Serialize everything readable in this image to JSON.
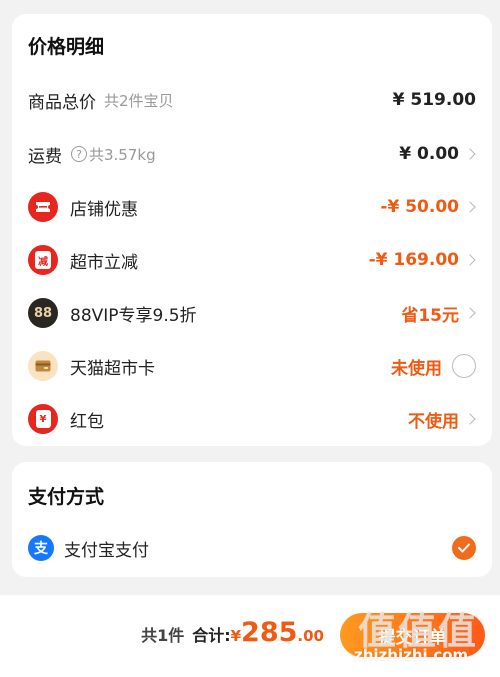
{
  "price_detail": {
    "title": "价格明细",
    "rows": [
      {
        "label": "商品总价",
        "sub": "共2件宝贝",
        "value": "¥ 519.00"
      },
      {
        "label": "运费",
        "sub": "共3.57kg",
        "value": "¥ 0.00"
      },
      {
        "label": "店铺优惠",
        "value": "-¥ 50.00",
        "icon": "ticket-icon"
      },
      {
        "label": "超市立减",
        "value": "-¥ 169.00",
        "icon": "reduction-badge-icon",
        "icon_text": "减"
      },
      {
        "label": "88VIP专享9.5折",
        "value": "省15元",
        "icon": "vip88-icon",
        "icon_text": "88"
      },
      {
        "label": "天猫超市卡",
        "value": "未使用",
        "icon": "wallet-card-icon"
      },
      {
        "label": "红包",
        "value": "不使用",
        "icon": "red-envelope-icon",
        "icon_text": "¥"
      }
    ]
  },
  "payment": {
    "title": "支付方式",
    "method_label": "支付宝支付",
    "method_icon": "alipay-icon",
    "method_icon_text": "支",
    "selected": true
  },
  "bottom_bar": {
    "count": "共1件",
    "total_label": "合计:",
    "currency": "¥",
    "amount": "285",
    "decimal": ".00",
    "submit_label": "提交订单"
  },
  "watermark": {
    "logo": "值值值",
    "text": "zhizhizhi.com"
  },
  "colors": {
    "accent": "#f05a12",
    "red_icon": "#e8251f",
    "alipay": "#1677ff",
    "check": "#f26b1d",
    "background": "#f2f2f2"
  }
}
